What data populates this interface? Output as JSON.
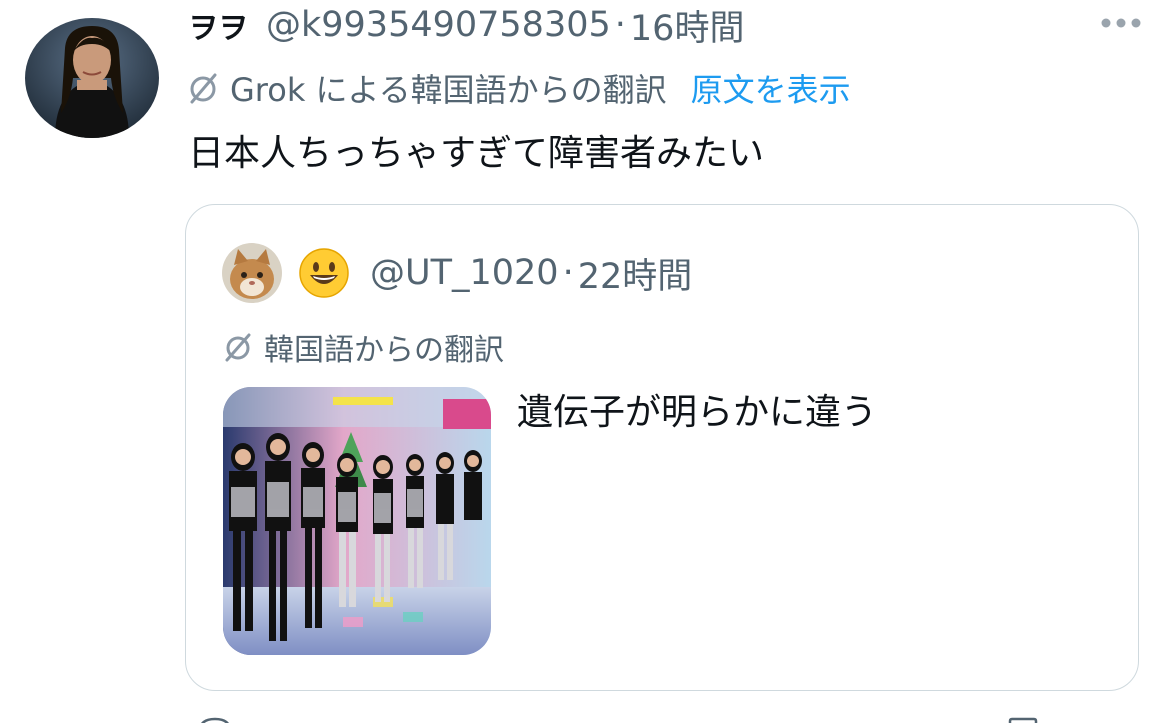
{
  "tweet": {
    "display_name": "ヲヲ",
    "handle": "@k9935490758305",
    "separator": "·",
    "time": "16時間",
    "translation_label": "Grok による韓国語からの翻訳",
    "show_original": "原文を表示",
    "text": "日本人ちっちゃすぎて障害者みたい"
  },
  "quote": {
    "emoji": "😀",
    "handle": "@UT_1020",
    "separator": "·",
    "time": "22時間",
    "translation_label": "韓国語からの翻訳",
    "text": "遺伝子が明らかに違う"
  },
  "icons": {
    "more": "more-dots-icon",
    "translate": "translate-slash-icon"
  },
  "colors": {
    "secondary_text": "#536471",
    "link": "#1d9bf0",
    "primary_text": "#0f1419",
    "border": "#cfd9de"
  }
}
